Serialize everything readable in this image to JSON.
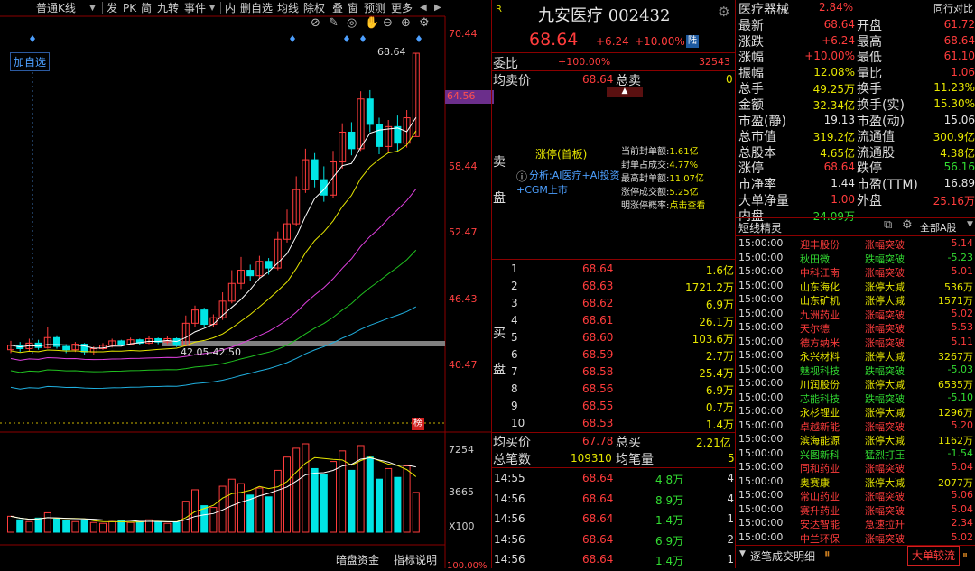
{
  "toolbar": {
    "items": [
      "普通K线",
      "发",
      "PK",
      "简",
      "九转",
      "事件",
      "内",
      "删自选",
      "均线",
      "除权",
      "叠",
      "窗",
      "预测",
      "更多"
    ]
  },
  "chart": {
    "add_watch": "加自选",
    "price_labels": [
      "70.44",
      "64.56",
      "58.44",
      "52.47",
      "46.43",
      "40.47"
    ],
    "current_tag": "64.56",
    "high_label": "68.64",
    "low_label": "42.05-42.50",
    "volume_labels": [
      "7254",
      "3665",
      "X100"
    ],
    "bottom_buttons": [
      "暗盘资金",
      "指标说明"
    ],
    "bottom_pct": "100.00%",
    "rank_tag": "榜"
  },
  "quote": {
    "r_mark": "R",
    "name_code": "九安医疗 002432",
    "price": "68.64",
    "change": "+6.24",
    "change_pct": "+10.00%",
    "board_tag": "陆",
    "weibi_label": "委比",
    "weibi_val": "+100.00%",
    "weibi_diff": "32543",
    "jmj_label": "均卖价",
    "jmj_val": "68.64",
    "zongmai_label": "总卖",
    "zongmai_val": "0",
    "sell_label": "卖盘",
    "zt_title": "涨停(首板)",
    "analysis": "分析:AI医疗+AI投资+CGM上市",
    "zt_stats": [
      {
        "k": "当前封单额:",
        "v": "1.61亿"
      },
      {
        "k": "封单占成交:",
        "v": "4.77%"
      },
      {
        "k": "最高封单额:",
        "v": "11.07亿"
      },
      {
        "k": "涨停成交额:",
        "v": "5.25亿"
      }
    ],
    "zt_prob_k": "明涨停概率:",
    "zt_prob_v": "点击查看",
    "buy_label": "买盘",
    "bids": [
      {
        "n": "1",
        "p": "68.64",
        "v": "1.6亿"
      },
      {
        "n": "2",
        "p": "68.63",
        "v": "1721.2万"
      },
      {
        "n": "3",
        "p": "68.62",
        "v": "6.9万"
      },
      {
        "n": "4",
        "p": "68.61",
        "v": "26.1万"
      },
      {
        "n": "5",
        "p": "68.60",
        "v": "103.6万"
      },
      {
        "n": "6",
        "p": "68.59",
        "v": "2.7万"
      },
      {
        "n": "7",
        "p": "68.58",
        "v": "25.4万"
      },
      {
        "n": "8",
        "p": "68.56",
        "v": "6.9万"
      },
      {
        "n": "9",
        "p": "68.55",
        "v": "0.7万"
      },
      {
        "n": "10",
        "p": "68.53",
        "v": "1.4万"
      }
    ],
    "jmj2_label": "均买价",
    "jmj2_val": "67.78",
    "zongmai2_label": "总买",
    "zongmai2_val": "2.21亿",
    "zbs_label": "总笔数",
    "zbs_val": "109310",
    "jbl_label": "均笔量",
    "jbl_val": "5",
    "ticks": [
      {
        "t": "14:55",
        "p": "68.64",
        "v": "4.8万",
        "n": "4"
      },
      {
        "t": "14:56",
        "p": "68.64",
        "v": "8.9万",
        "n": "4"
      },
      {
        "t": "14:56",
        "p": "68.64",
        "v": "1.4万",
        "n": "1"
      },
      {
        "t": "14:56",
        "p": "68.64",
        "v": "6.9万",
        "n": "2"
      },
      {
        "t": "14:56",
        "p": "68.64",
        "v": "1.4万",
        "n": "1"
      }
    ]
  },
  "right": {
    "sector": "医疗器械",
    "sector_pct": "2.84%",
    "peer": "同行对比",
    "rows": [
      {
        "l": "最新",
        "v": "68.64",
        "c": "red",
        "l2": "开盘",
        "v2": "61.72",
        "c2": "red"
      },
      {
        "l": "涨跌",
        "v": "+6.24",
        "c": "red",
        "l2": "最高",
        "v2": "68.64",
        "c2": "red"
      },
      {
        "l": "涨幅",
        "v": "+10.00%",
        "c": "red",
        "l2": "最低",
        "v2": "61.10",
        "c2": "red"
      },
      {
        "l": "振幅",
        "v": "12.08%",
        "c": "yellow",
        "l2": "量比",
        "v2": "1.06",
        "c2": "red"
      },
      {
        "l": "总手",
        "v": "49.25万",
        "c": "yellow",
        "l2": "换手",
        "v2": "11.23%",
        "c2": "yellow"
      },
      {
        "l": "金额",
        "v": "32.34亿",
        "c": "yellow",
        "l2": "换手(实)",
        "v2": "15.30%",
        "c2": "yellow"
      },
      {
        "l": "市盈(静)",
        "v": "19.13",
        "c": "white",
        "l2": "市盈(动)",
        "v2": "15.06",
        "c2": "white"
      },
      {
        "l": "总市值",
        "v": "319.2亿",
        "c": "yellow",
        "l2": "流通值",
        "v2": "300.9亿",
        "c2": "yellow"
      },
      {
        "l": "总股本",
        "v": "4.65亿",
        "c": "yellow",
        "l2": "流通股",
        "v2": "4.38亿",
        "c2": "yellow"
      },
      {
        "l": "涨停",
        "v": "68.64",
        "c": "red",
        "l2": "跌停",
        "v2": "56.16",
        "c2": "green"
      },
      {
        "l": "市净率",
        "v": "1.44",
        "c": "white",
        "l2": "市盈(TTM)",
        "v2": "16.89",
        "c2": "white"
      },
      {
        "l": "大单净量",
        "v": "1.00",
        "c": "red",
        "l2": "外盘",
        "v2": "25.16万",
        "c2": "red"
      },
      {
        "l": "内盘",
        "v": "24.09万",
        "c": "green",
        "l2": "",
        "v2": "",
        "c2": "white"
      }
    ],
    "dx_title": "短线精灵",
    "dx_scope": "全部A股",
    "tape": [
      {
        "t": "15:00:00",
        "n": "迎丰股份",
        "e": "涨幅突破",
        "v": "5.14",
        "c": "red"
      },
      {
        "t": "15:00:00",
        "n": "秋田微",
        "e": "跌幅突破",
        "v": "-5.23",
        "c": "green"
      },
      {
        "t": "15:00:00",
        "n": "中科江南",
        "e": "涨幅突破",
        "v": "5.01",
        "c": "red"
      },
      {
        "t": "15:00:00",
        "n": "山东海化",
        "e": "涨停大减",
        "v": "536万",
        "c": "yellow"
      },
      {
        "t": "15:00:00",
        "n": "山东矿机",
        "e": "涨停大减",
        "v": "1571万",
        "c": "yellow"
      },
      {
        "t": "15:00:00",
        "n": "九洲药业",
        "e": "涨幅突破",
        "v": "5.02",
        "c": "red"
      },
      {
        "t": "15:00:00",
        "n": "天尔德",
        "e": "涨幅突破",
        "v": "5.53",
        "c": "red"
      },
      {
        "t": "15:00:00",
        "n": "德方纳米",
        "e": "涨幅突破",
        "v": "5.11",
        "c": "red"
      },
      {
        "t": "15:00:00",
        "n": "永兴材料",
        "e": "涨停大减",
        "v": "3267万",
        "c": "yellow"
      },
      {
        "t": "15:00:00",
        "n": "魅视科技",
        "e": "跌幅突破",
        "v": "-5.03",
        "c": "green"
      },
      {
        "t": "15:00:00",
        "n": "川润股份",
        "e": "涨停大减",
        "v": "6535万",
        "c": "yellow"
      },
      {
        "t": "15:00:00",
        "n": "芯能科技",
        "e": "跌幅突破",
        "v": "-5.10",
        "c": "green"
      },
      {
        "t": "15:00:00",
        "n": "永杉锂业",
        "e": "涨停大减",
        "v": "1296万",
        "c": "yellow"
      },
      {
        "t": "15:00:00",
        "n": "卓越新能",
        "e": "涨幅突破",
        "v": "5.20",
        "c": "red"
      },
      {
        "t": "15:00:00",
        "n": "滨海能源",
        "e": "涨停大减",
        "v": "1162万",
        "c": "yellow"
      },
      {
        "t": "15:00:00",
        "n": "兴图新科",
        "e": "猛烈打压",
        "v": "-1.54",
        "c": "green"
      },
      {
        "t": "15:00:00",
        "n": "同和药业",
        "e": "涨幅突破",
        "v": "5.04",
        "c": "red"
      },
      {
        "t": "15:00:00",
        "n": "奥赛康",
        "e": "涨停大减",
        "v": "2077万",
        "c": "yellow"
      },
      {
        "t": "15:00:00",
        "n": "常山药业",
        "e": "涨幅突破",
        "v": "5.06",
        "c": "red"
      },
      {
        "t": "15:00:00",
        "n": "赛升药业",
        "e": "涨幅突破",
        "v": "5.04",
        "c": "red"
      },
      {
        "t": "15:00:00",
        "n": "安达智能",
        "e": "急速拉升",
        "v": "2.34",
        "c": "red"
      },
      {
        "t": "15:00:00",
        "n": "中兰环保",
        "e": "涨幅突破",
        "v": "5.02",
        "c": "red"
      }
    ],
    "bottom_left": "逐笔成交明细",
    "bottom_right": "大单较流"
  },
  "colors": {
    "up": "#ff3c3c",
    "down": "#00e5e5",
    "ma5": "#ffffff",
    "ma10": "#e6e600",
    "ma20": "#e040e0",
    "ma30": "#20c020",
    "ma60": "#20b0e0"
  }
}
